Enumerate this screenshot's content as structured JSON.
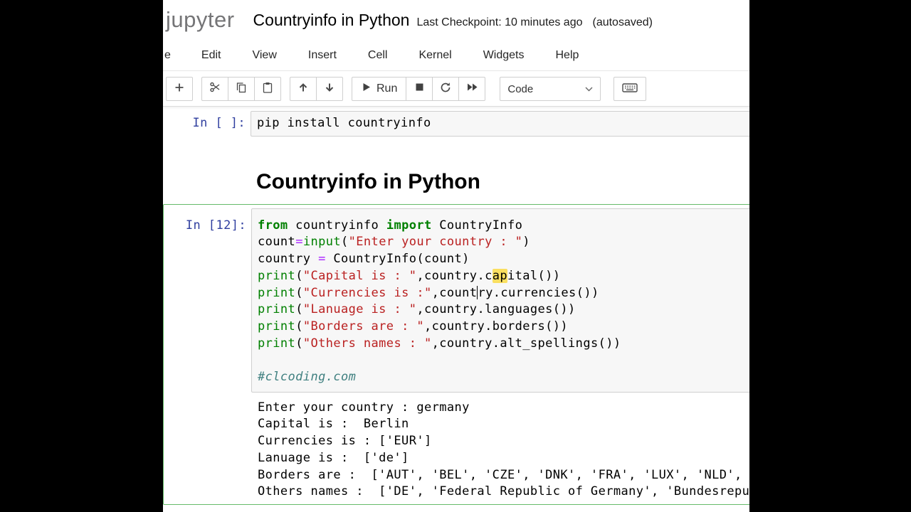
{
  "header": {
    "logo": "jupyter",
    "title": "Countryinfo in Python",
    "checkpoint": "Last Checkpoint: 10 minutes ago",
    "autosaved": "(autosaved)"
  },
  "menu": {
    "items": [
      "e",
      "Edit",
      "View",
      "Insert",
      "Cell",
      "Kernel",
      "Widgets",
      "Help"
    ]
  },
  "toolbar": {
    "run_label": "Run",
    "cell_type": "Code",
    "icon_names": [
      "add-cell-icon",
      "cut-icon",
      "copy-icon",
      "paste-icon",
      "move-up-icon",
      "move-down-icon",
      "play-icon",
      "stop-icon",
      "restart-kernel-icon",
      "restart-run-all-icon",
      "chevron-down-icon",
      "keyboard-icon"
    ]
  },
  "colors": {
    "keyword": "#008000",
    "builtin": "#008000",
    "string": "#BA2121",
    "operator": "#AA22FF",
    "comment": "#408080",
    "prompt": "#303F9F",
    "edit_mode_border": "#66BB6A",
    "cell_background": "#f7f7f7"
  },
  "cell1": {
    "prompt": "In [ ]:",
    "code": [
      [
        {
          "s": "pip install countryinfo",
          "c": "p"
        }
      ]
    ]
  },
  "markdown_cell": {
    "heading": "Countryinfo in Python"
  },
  "cell2": {
    "prompt": "In [12]:",
    "code": [
      [
        {
          "s": "from",
          "c": "kw"
        },
        {
          "s": " countryinfo ",
          "c": "p"
        },
        {
          "s": "import",
          "c": "kw"
        },
        {
          "s": " CountryInfo",
          "c": "p"
        }
      ],
      [
        {
          "s": "count",
          "c": "p"
        },
        {
          "s": "=",
          "c": "op"
        },
        {
          "s": "input",
          "c": "bi"
        },
        {
          "s": "(",
          "c": "p"
        },
        {
          "s": "\"Enter your country : \"",
          "c": "st"
        },
        {
          "s": ")",
          "c": "p"
        }
      ],
      [
        {
          "s": "country ",
          "c": "p"
        },
        {
          "s": "=",
          "c": "op"
        },
        {
          "s": " CountryInfo(count)",
          "c": "p"
        }
      ],
      [
        {
          "s": "print",
          "c": "bi"
        },
        {
          "s": "(",
          "c": "p"
        },
        {
          "s": "\"Capital is : \"",
          "c": "st"
        },
        {
          "s": ",country.c",
          "c": "p"
        },
        {
          "s": "ap",
          "c": "hl"
        },
        {
          "s": "ital())",
          "c": "p"
        }
      ],
      [
        {
          "s": "print",
          "c": "bi"
        },
        {
          "s": "(",
          "c": "p"
        },
        {
          "s": "\"Currencies is :\"",
          "c": "st"
        },
        {
          "s": ",count",
          "c": "p"
        },
        {
          "s": "",
          "c": "cur"
        },
        {
          "s": "ry.currencies())",
          "c": "p"
        }
      ],
      [
        {
          "s": "print",
          "c": "bi"
        },
        {
          "s": "(",
          "c": "p"
        },
        {
          "s": "\"Lanuage is : \"",
          "c": "st"
        },
        {
          "s": ",country.languages())",
          "c": "p"
        }
      ],
      [
        {
          "s": "print",
          "c": "bi"
        },
        {
          "s": "(",
          "c": "p"
        },
        {
          "s": "\"Borders are : \"",
          "c": "st"
        },
        {
          "s": ",country.borders())",
          "c": "p"
        }
      ],
      [
        {
          "s": "print",
          "c": "bi"
        },
        {
          "s": "(",
          "c": "p"
        },
        {
          "s": "\"Others names : \"",
          "c": "st"
        },
        {
          "s": ",country.alt_spellings())",
          "c": "p"
        }
      ],
      [],
      [
        {
          "s": "#clcoding.com",
          "c": "cm"
        }
      ]
    ],
    "output": [
      "Enter your country : germany",
      "Capital is :  Berlin",
      "Currencies is : ['EUR']",
      "Lanuage is :  ['de']",
      "Borders are :  ['AUT', 'BEL', 'CZE', 'DNK', 'FRA', 'LUX', 'NLD', '",
      "Others names :  ['DE', 'Federal Republic of Germany', 'Bundesrepub"
    ]
  }
}
